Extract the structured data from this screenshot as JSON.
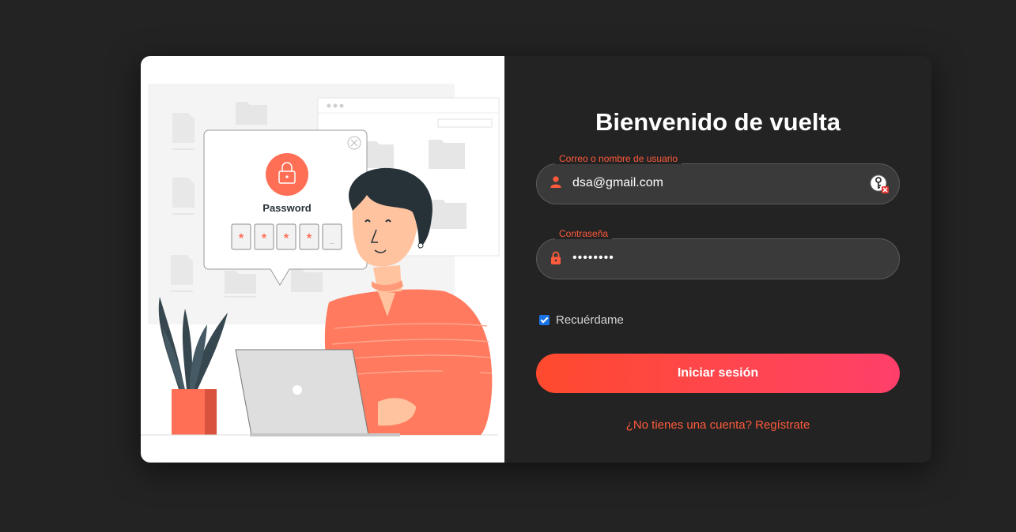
{
  "illustration": {
    "dialog_label": "Password",
    "pin_chars": [
      "*",
      "*",
      "*",
      "*",
      "_"
    ]
  },
  "form": {
    "title": "Bienvenido de vuelta",
    "username": {
      "label": "Correo o nombre de usuario",
      "value": "dsa@gmail.com",
      "icon": "user-icon"
    },
    "password": {
      "label": "Contraseña",
      "value": "••••••••",
      "icon": "lock-icon"
    },
    "remember_label": "Recuérdame",
    "remember_checked": true,
    "submit_label": "Iniciar sesión",
    "register_text": "¿No tienes una cuenta? Regístrate"
  },
  "colors": {
    "page_background": "#232323",
    "accent": "#ff5a3c",
    "button_gradient_start": "#ff4a2e",
    "button_gradient_end": "#ff3f6a",
    "input_background": "#3a3a3a"
  }
}
